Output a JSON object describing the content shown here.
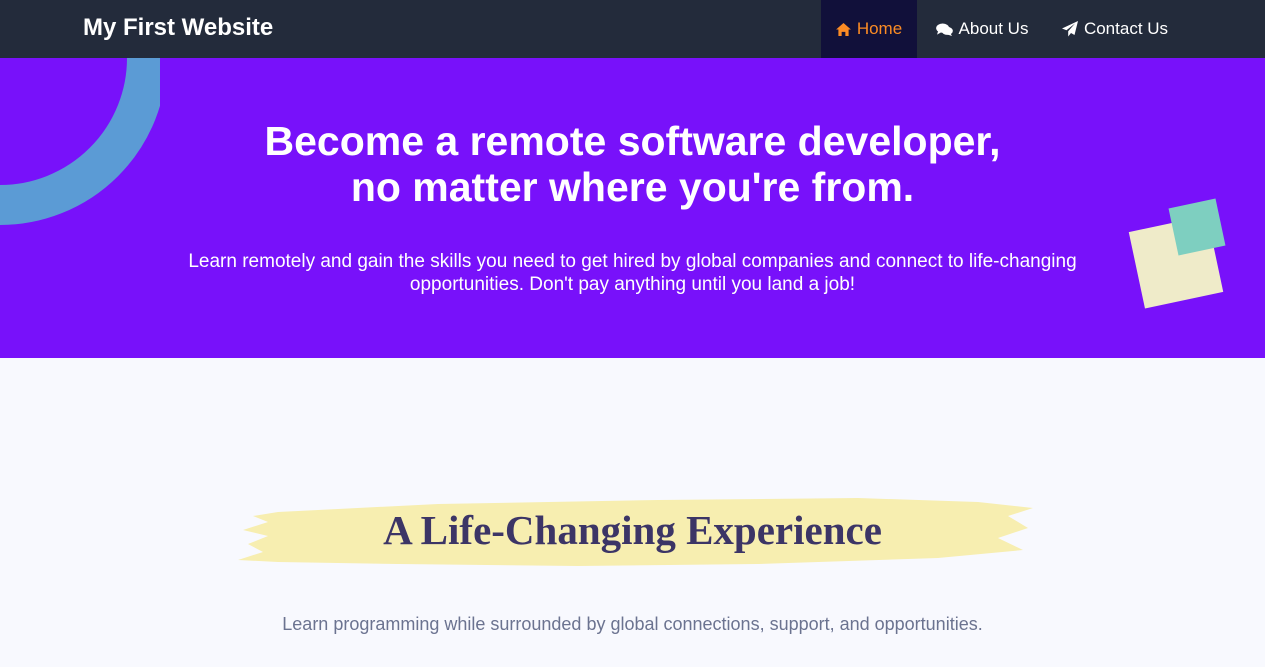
{
  "navbar": {
    "brand": "My First Website",
    "items": [
      {
        "label": "Home",
        "icon": "home-icon",
        "active": true
      },
      {
        "label": "About Us",
        "icon": "comments-icon",
        "active": false
      },
      {
        "label": "Contact Us",
        "icon": "paper-plane-icon",
        "active": false
      }
    ]
  },
  "hero": {
    "title_line1": "Become a remote software developer,",
    "title_line2": "no matter where you're from.",
    "subtitle": "Learn remotely and gain the skills you need to get hired by global companies and connect to life-changing opportunities. Don't pay anything until you land a job!"
  },
  "section": {
    "title": "A Life-Changing Experience",
    "subtitle": "Learn programming while surrounded by global connections, support, and opportunities."
  },
  "colors": {
    "navbar_bg": "#232b3b",
    "nav_active_bg": "#11103a",
    "nav_active_text": "#fb8b24",
    "hero_bg": "#7811fa",
    "ring": "#5b9bd5",
    "square_teal": "#7ecfc0",
    "square_cream": "#efebc9",
    "brush_yellow": "#f7eeb0",
    "section_title": "#3c3566",
    "section_sub": "#6b7390",
    "page_bg": "#f8f9fe"
  }
}
